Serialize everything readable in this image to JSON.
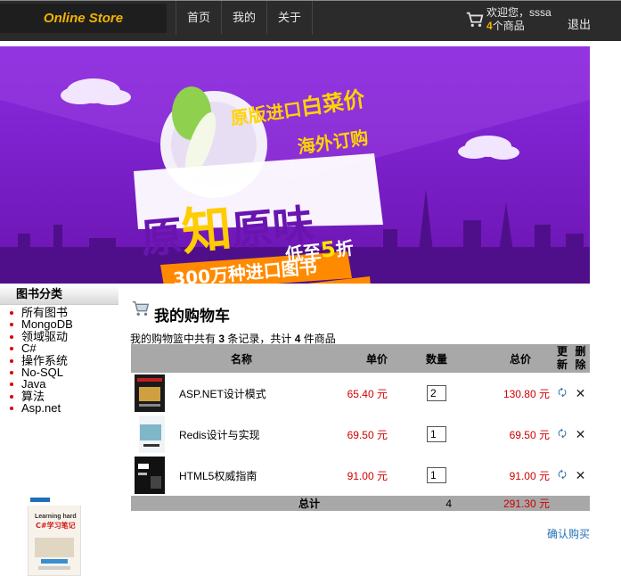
{
  "header": {
    "logo": "Online Store",
    "nav": [
      {
        "label": "首页"
      },
      {
        "label": "我的"
      },
      {
        "label": "关于"
      }
    ],
    "cart_icon": "cart-icon",
    "greeting": "欢迎您，sssa",
    "cart_count": "4",
    "cart_count_suffix": "个商品",
    "logout": "退出"
  },
  "banner": {
    "line1_a": "原版进口",
    "line1_b": "白菜价",
    "line2": "海外订购",
    "big_a": "原",
    "big_b": "知",
    "big_c": "原味",
    "ribbon1": "300万种进口图书",
    "ribbon2_a": "低至",
    "ribbon2_b": "5",
    "ribbon2_c": "折"
  },
  "sidebar": {
    "title": "图书分类",
    "items": [
      {
        "label": "所有图书"
      },
      {
        "label": "MongoDB"
      },
      {
        "label": "领域驱动"
      },
      {
        "label": "C#"
      },
      {
        "label": "操作系统"
      },
      {
        "label": "No-SQL"
      },
      {
        "label": "Java"
      },
      {
        "label": "算法"
      },
      {
        "label": "Asp.net"
      }
    ],
    "book_cover_title": "Learning hard C#学习笔记"
  },
  "cart": {
    "title": "我的购物车",
    "summary_prefix": "我的购物篮中共有 ",
    "record_count": "3",
    "summary_mid": " 条记录，共计 ",
    "item_count": "4",
    "summary_suffix": " 件商品",
    "columns": {
      "name": "名称",
      "price": "单价",
      "qty": "数量",
      "total": "总价",
      "update": "更新",
      "delete": "删除"
    },
    "rows": [
      {
        "name": "ASP.NET设计模式",
        "price": "65.40 元",
        "qty": "2",
        "total": "130.80 元"
      },
      {
        "name": "Redis设计与实现",
        "price": "69.50 元",
        "qty": "1",
        "total": "69.50 元"
      },
      {
        "name": "HTML5权威指南",
        "price": "91.00 元",
        "qty": "1",
        "total": "91.00 元"
      }
    ],
    "footer": {
      "label": "总计",
      "qty": "4",
      "sum": "291.30 元"
    },
    "confirm": "确认购买"
  },
  "colors": {
    "topbar": "#2b2b2b",
    "accent": "#f0b400",
    "price_red": "#d00000",
    "link_blue": "#1f6fb8",
    "banner_purple": "#7a1fc4"
  }
}
